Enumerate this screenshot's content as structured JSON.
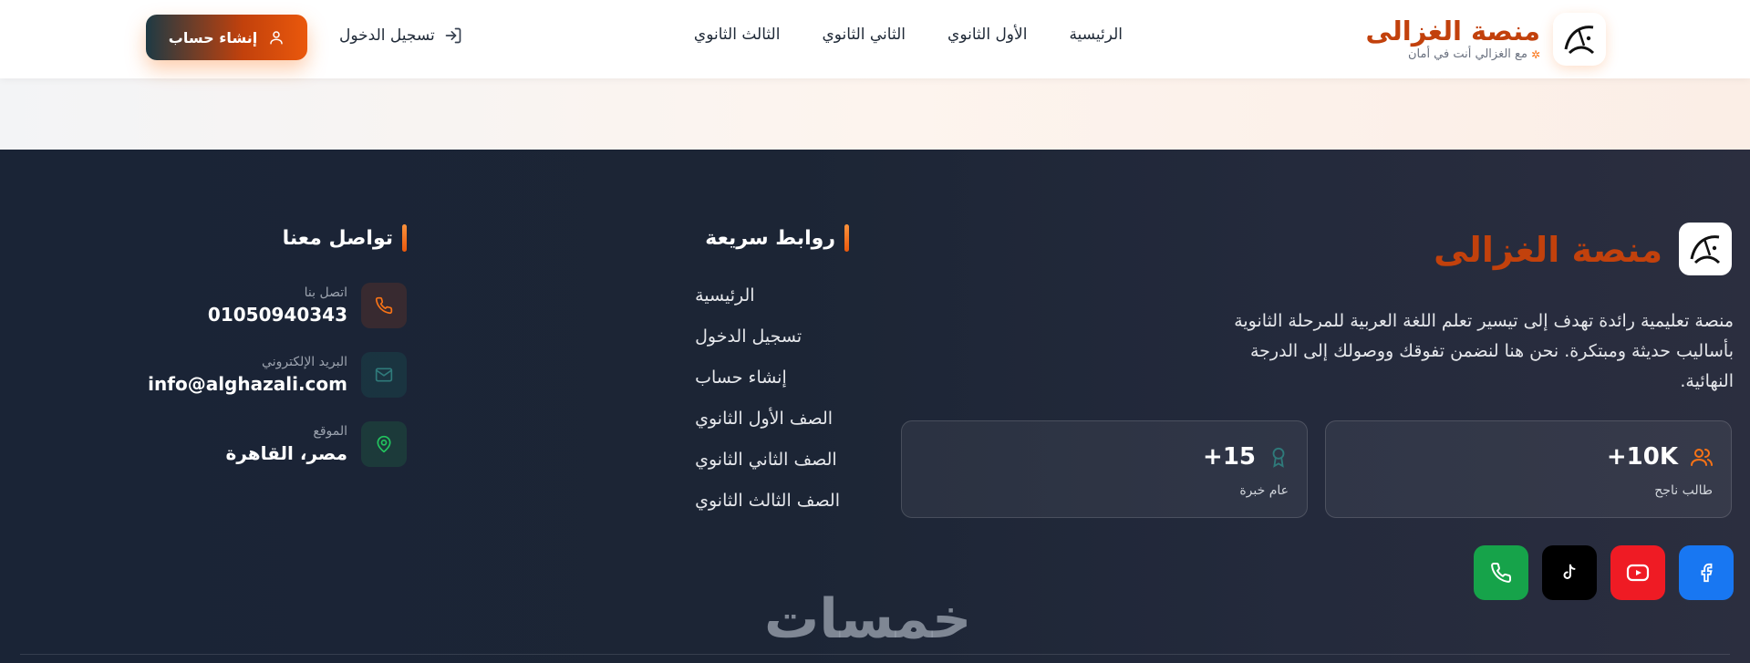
{
  "header": {
    "brand_title": "منصة الغزالى",
    "brand_subtitle": "مع الغزالي أنت في أمان",
    "logo_glyph": "الغزالي",
    "nav": [
      "الرئيسية",
      "الأول الثانوي",
      "الثاني الثانوي",
      "الثالث الثانوي"
    ],
    "login_label": "تسجيل الدخول",
    "signup_label": "إنشاء حساب"
  },
  "footer": {
    "brand_title": "منصة الغزالى",
    "description": "منصة تعليمية رائدة تهدف إلى تيسير تعلم اللغة العربية للمرحلة الثانوية بأساليب حديثة ومبتكرة. نحن هنا لنضمن تفوقك ووصولك إلى الدرجة النهائية.",
    "stats": [
      {
        "value": "+10K",
        "label": "طالب ناجح",
        "icon": "users-icon"
      },
      {
        "value": "+15",
        "label": "عام خبرة",
        "icon": "award-icon"
      }
    ],
    "socials": [
      "facebook",
      "youtube",
      "tiktok",
      "phone"
    ],
    "quick_links_title": "روابط سريعة",
    "quick_links": [
      "الرئيسية",
      "تسجيل الدخول",
      "إنشاء حساب",
      "الصف الأول الثانوي",
      "الصف الثاني الثانوي",
      "الصف الثالث الثانوي"
    ],
    "contact_title": "تواصل معنا",
    "contact": [
      {
        "label": "اتصل بنا",
        "value": "01050940343",
        "icon": "phone-icon"
      },
      {
        "label": "البريد الإلكتروني",
        "value": "info@alghazali.com",
        "icon": "mail-icon"
      },
      {
        "label": "الموقع",
        "value": "مصر، القاهرة",
        "icon": "map-pin-icon"
      }
    ],
    "watermark": "خمسات"
  },
  "colors": {
    "accent": "#ea580c",
    "footer_bg": "#1c2535",
    "facebook": "#1877f2",
    "youtube": "#ef1b24",
    "tiktok": "#000000",
    "whatsapp": "#16a34a"
  }
}
